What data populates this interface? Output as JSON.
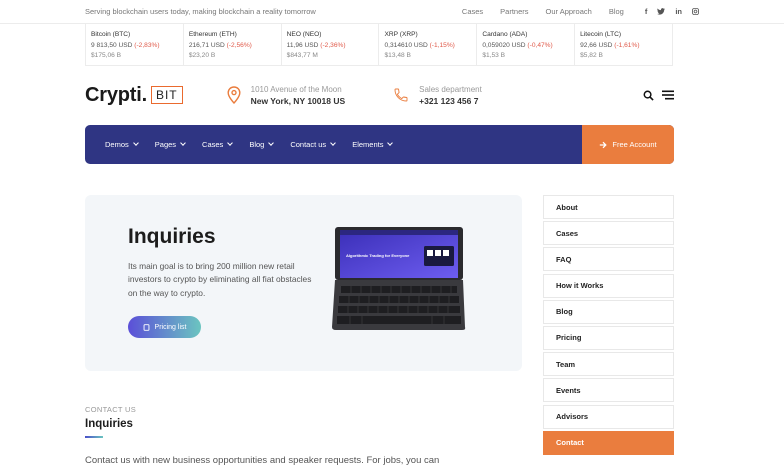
{
  "topbar": {
    "tagline": "Serving blockchain users today, making blockchain a reality tomorrow",
    "links": [
      "Cases",
      "Partners",
      "Our Approach",
      "Blog"
    ],
    "social": [
      "f-icon",
      "twitter-icon",
      "linkedin-icon",
      "instagram-icon"
    ]
  },
  "ticker": [
    {
      "name": "Bitcoin (BTC)",
      "price": "9 813,50 USD",
      "change": "(-2,83%)",
      "volume": "$175,06 B"
    },
    {
      "name": "Ethereum (ETH)",
      "price": "216,71 USD",
      "change": "(-2,56%)",
      "volume": "$23,20 B"
    },
    {
      "name": "NEO (NEO)",
      "price": "11,96 USD",
      "change": "(-2,36%)",
      "volume": "$843,77 M"
    },
    {
      "name": "XRP (XRP)",
      "price": "0,314610 USD",
      "change": "(-1,15%)",
      "volume": "$13,48 B"
    },
    {
      "name": "Cardano (ADA)",
      "price": "0,059020 USD",
      "change": "(-0,47%)",
      "volume": "$1,53 B"
    },
    {
      "name": "Litecoin (LTC)",
      "price": "92,66 USD",
      "change": "(-1,61%)",
      "volume": "$5,82 B"
    }
  ],
  "header": {
    "logo": "Crypti.",
    "logo_badge": "BIT",
    "address_label": "1010 Avenue of the Moon",
    "address_value": "New York, NY 10018 US",
    "phone_label": "Sales department",
    "phone_value": "+321 123 456 7"
  },
  "nav": {
    "items": [
      "Demos",
      "Pages",
      "Cases",
      "Blog",
      "Contact us",
      "Elements"
    ],
    "cta": "Free Account"
  },
  "hero": {
    "title": "Inquiries",
    "text": "Its main goal is to bring 200 million new retail investors to crypto by eliminating all fiat obstacles on the way to crypto.",
    "button": "Pricing list",
    "device_caption": "Algorithmic Trading for Everyone"
  },
  "sidebar": {
    "items": [
      "About",
      "Cases",
      "FAQ",
      "How it Works",
      "Blog",
      "Pricing",
      "Team",
      "Events",
      "Advisors",
      "Contact"
    ],
    "active": "Contact"
  },
  "contact": {
    "eyebrow": "CONTACT US",
    "title": "Inquiries",
    "text": "Contact us with new business opportunities and speaker requests. For jobs, you can"
  },
  "colors": {
    "accent": "#ea7d3e",
    "nav_bg": "#2f3583",
    "negative": "#e05a4a"
  }
}
